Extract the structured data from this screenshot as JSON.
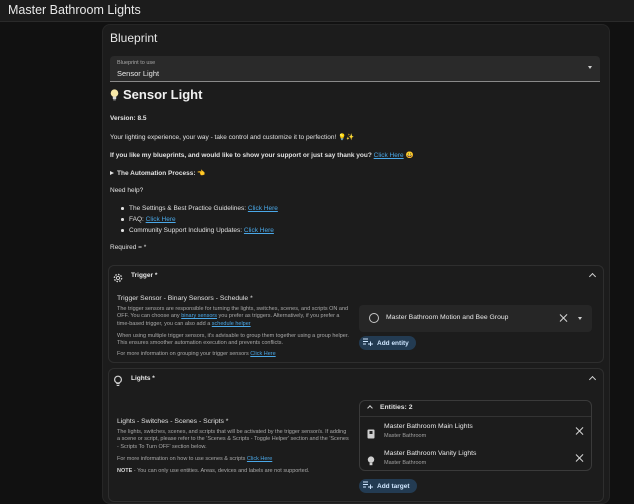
{
  "window": {
    "title": "Master Bathroom Lights"
  },
  "blueprint": {
    "heading": "Blueprint",
    "select_label": "Blueprint to use",
    "select_value": "Sensor Light"
  },
  "description": {
    "title": "Sensor Light",
    "version": "Version: 8.5",
    "tagline": "Your lighting experience, your way - take control and customize it to perfection! 💡✨",
    "support_text": "If you like my blueprints, and would like to show your support or just say thank you?",
    "support_link": "Click Here",
    "support_emoji": "😀",
    "process": "The Automation Process: 👈",
    "help": "Need help?",
    "links": [
      {
        "label": "The Settings & Best Practice Guidelines:",
        "link": "Click Here"
      },
      {
        "label": "FAQ:",
        "link": "Click Here"
      },
      {
        "label": "Community Support Including Updates:",
        "link": "Click Here"
      }
    ],
    "required": "Required = *"
  },
  "trigger": {
    "name": "Trigger *",
    "field_title": "Trigger Sensor - Binary Sensors - Schedule *",
    "desc1_a": "The trigger sensors are responsible for turning the lights, switches, scenes, and scripts ON and OFF. You can choose any",
    "desc1_link": "binary sensors",
    "desc1_b": "you prefer as triggers. Alternatively, if you prefer a time-based trigger, you can also add a",
    "desc1_link2": "schedule helper",
    "desc2": "When using multiple trigger sensors, it's advisable to group them together using a group helper. This ensures smoother automation execution and prevents conflicts.",
    "desc3": "For more information on grouping your trigger sensors",
    "desc3_link": "Click Here",
    "selected": "Master Bathroom Motion and Bee Group",
    "add_label": "Add entity"
  },
  "lights": {
    "name": "Lights *",
    "field_title": "Lights - Switches - Scenes - Scripts *",
    "desc1": "The lights, switches, scenes, and scripts that will be activated by the trigger sensor/s. If adding a scene or script, please refer to the 'Scenes & Scripts - Toggle Helper' section and the 'Scenes - Scripts To Turn OFF' section below.",
    "desc2": "For more information on how to use scenes & scripts",
    "desc2_link": "Click Here",
    "note_label": "NOTE",
    "note": " - You can only use entities. Areas, devices and labels are not supported.",
    "entities_header": "Entities: 2",
    "entities": [
      {
        "name": "Master Bathroom Main Lights",
        "area": "Master Bathroom",
        "icon": "switch-icon"
      },
      {
        "name": "Master Bathroom Vanity Lights",
        "area": "Master Bathroom",
        "icon": "bulb-icon"
      }
    ],
    "add_label": "Add target"
  },
  "colors": {
    "link": "#4aa8e8",
    "chip": "#233b52",
    "accent": "#cfe6ff"
  }
}
